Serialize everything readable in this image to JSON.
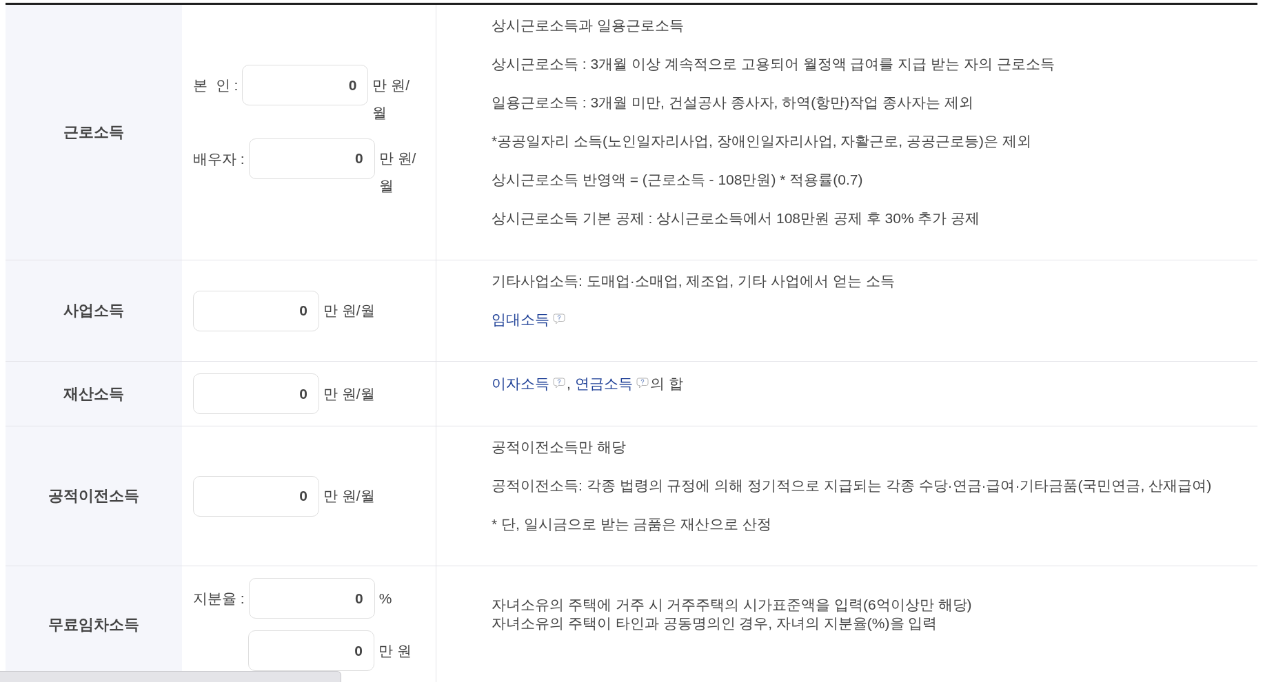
{
  "rows": [
    {
      "header": "근로소득",
      "fields": [
        {
          "label": "본  인 :",
          "value": "0",
          "unit": "만 원/월"
        },
        {
          "label": "배우자 :",
          "value": "0",
          "unit": "만 원/월"
        }
      ],
      "notes": [
        {
          "text": "상시근로소득과 일용근로소득"
        },
        {
          "text": "상시근로소득 : 3개월 이상 계속적으로 고용되어 월정액 급여를 지급 받는 자의 근로소득"
        },
        {
          "text": "일용근로소득 : 3개월 미만, 건설공사 종사자, 하역(항만)작업 종사자는 제외"
        },
        {
          "text": "*공공일자리 소득(노인일자리사업, 장애인일자리사업, 자활근로, 공공근로등)은 제외"
        },
        {
          "text": "상시근로소득 반영액 = (근로소득 - 108만원) * 적용률(0.7)"
        },
        {
          "text": "상시근로소득 기본 공제 : 상시근로소득에서 108만원 공제 후 30% 추가 공제"
        }
      ]
    },
    {
      "header": "사업소득",
      "fields": [
        {
          "value": "0",
          "unit": "만 원/월"
        }
      ],
      "notes": [
        {
          "text": "기타사업소득: 도매업·소매업, 제조업, 기타 사업에서 얻는 소득"
        },
        {
          "links": [
            {
              "text": "임대소득",
              "help": true
            }
          ]
        }
      ]
    },
    {
      "header": "재산소득",
      "fields": [
        {
          "value": "0",
          "unit": "만 원/월"
        }
      ],
      "notes": [
        {
          "links": [
            {
              "text": "이자소득",
              "help": true
            },
            {
              "text": "연금소득",
              "help": true
            }
          ],
          "separator": ", ",
          "suffix": "의 합"
        }
      ]
    },
    {
      "header": "공적이전소득",
      "fields": [
        {
          "value": "0",
          "unit": "만 원/월"
        }
      ],
      "notes": [
        {
          "text": "공적이전소득만 해당"
        },
        {
          "text": "공적이전소득: 각종 법령의 규정에 의해 정기적으로 지급되는 각종 수당·연금·급여·기타금품(국민연금, 산재급여)"
        },
        {
          "text": "* 단, 일시금으로 받는 금품은 재산으로 산정"
        }
      ]
    },
    {
      "header": "무료임차소득",
      "fields": [
        {
          "label": "지분율 :",
          "value": "0",
          "unit": "%"
        },
        {
          "value": "0",
          "unit": "만 원"
        }
      ],
      "notes": [
        {
          "text": "자녀소유의 주택에 거주 시 거주주택의 시가표준액을 입력(6억이상만 해당)\n자녀소유의 주택이 타인과 공동명의인 경우, 자녀의 지분율(%)을 입력"
        }
      ]
    }
  ]
}
